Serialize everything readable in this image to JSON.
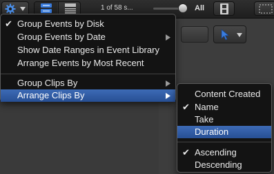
{
  "toolbar": {
    "clip_count": "1 of 58 s...",
    "filter_label": "All"
  },
  "menu": {
    "items": [
      {
        "label": "Group Events by Disk",
        "checked": true
      },
      {
        "label": "Group Events by Date",
        "has_submenu": true
      },
      {
        "label": "Show Date Ranges in Event Library"
      },
      {
        "label": "Arrange Events by Most Recent"
      },
      {
        "label": "Group Clips By",
        "has_submenu": true
      },
      {
        "label": "Arrange Clips By",
        "has_submenu": true,
        "highlighted": true
      }
    ]
  },
  "submenu": {
    "items": [
      {
        "label": "Content Created"
      },
      {
        "label": "Name",
        "checked": true
      },
      {
        "label": "Take"
      },
      {
        "label": "Duration",
        "highlighted": true
      },
      {
        "label": "Ascending",
        "checked": true
      },
      {
        "label": "Descending"
      }
    ]
  },
  "glyphs": {
    "check": "✔"
  },
  "colors": {
    "highlight": "#2f5ca6",
    "gear_accent": "#4a8ee8",
    "pointer_accent": "#3a7de0"
  },
  "icons": {
    "gear": "gear-icon",
    "pointer": "arrow-pointer-icon",
    "filmstrip": "filmstrip-icon",
    "list_view": "list-view-icon",
    "grid_view": "filmstrip-view-icon"
  }
}
